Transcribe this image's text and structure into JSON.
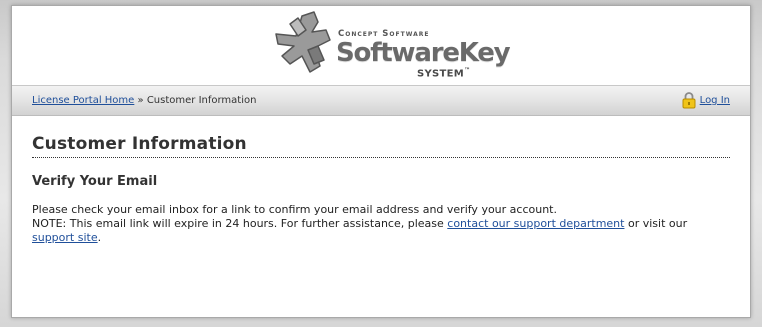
{
  "header": {
    "logo": {
      "company": "Concept Software",
      "product": "SoftwareKey",
      "system": "SYSTEM",
      "trademark": "™"
    }
  },
  "nav": {
    "breadcrumb_home": "License Portal Home",
    "separator": " » ",
    "breadcrumb_current": "Customer Information",
    "login_label": "Log In",
    "lock_icon": "lock-icon"
  },
  "main": {
    "title": "Customer Information",
    "subtitle": "Verify Your Email",
    "line1": "Please check your email inbox for a link to confirm your email address and verify your account.",
    "line2_prefix": "NOTE: This email link will expire in 24 hours. For further assistance, please ",
    "contact_link": "contact our support department",
    "line2_middle": " or visit our ",
    "support_link": "support site",
    "line2_suffix": "."
  },
  "colors": {
    "link": "#1f4f9a",
    "text": "#333333",
    "lock": "#e8b700"
  }
}
